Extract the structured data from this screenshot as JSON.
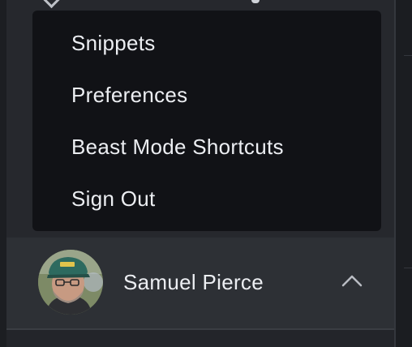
{
  "menu": {
    "items": [
      {
        "label": "Snippets"
      },
      {
        "label": "Preferences"
      },
      {
        "label": "Beast Mode Shortcuts"
      },
      {
        "label": "Sign Out"
      }
    ]
  },
  "user": {
    "name": "Samuel Pierce",
    "avatar_icon": "user-avatar-photo",
    "toggle_icon": "chevron-up-icon"
  },
  "colors": {
    "menu_background": "#111216",
    "sidebar_background": "#26282d",
    "user_bar_background": "#2d3035",
    "text": "#eceef2"
  }
}
